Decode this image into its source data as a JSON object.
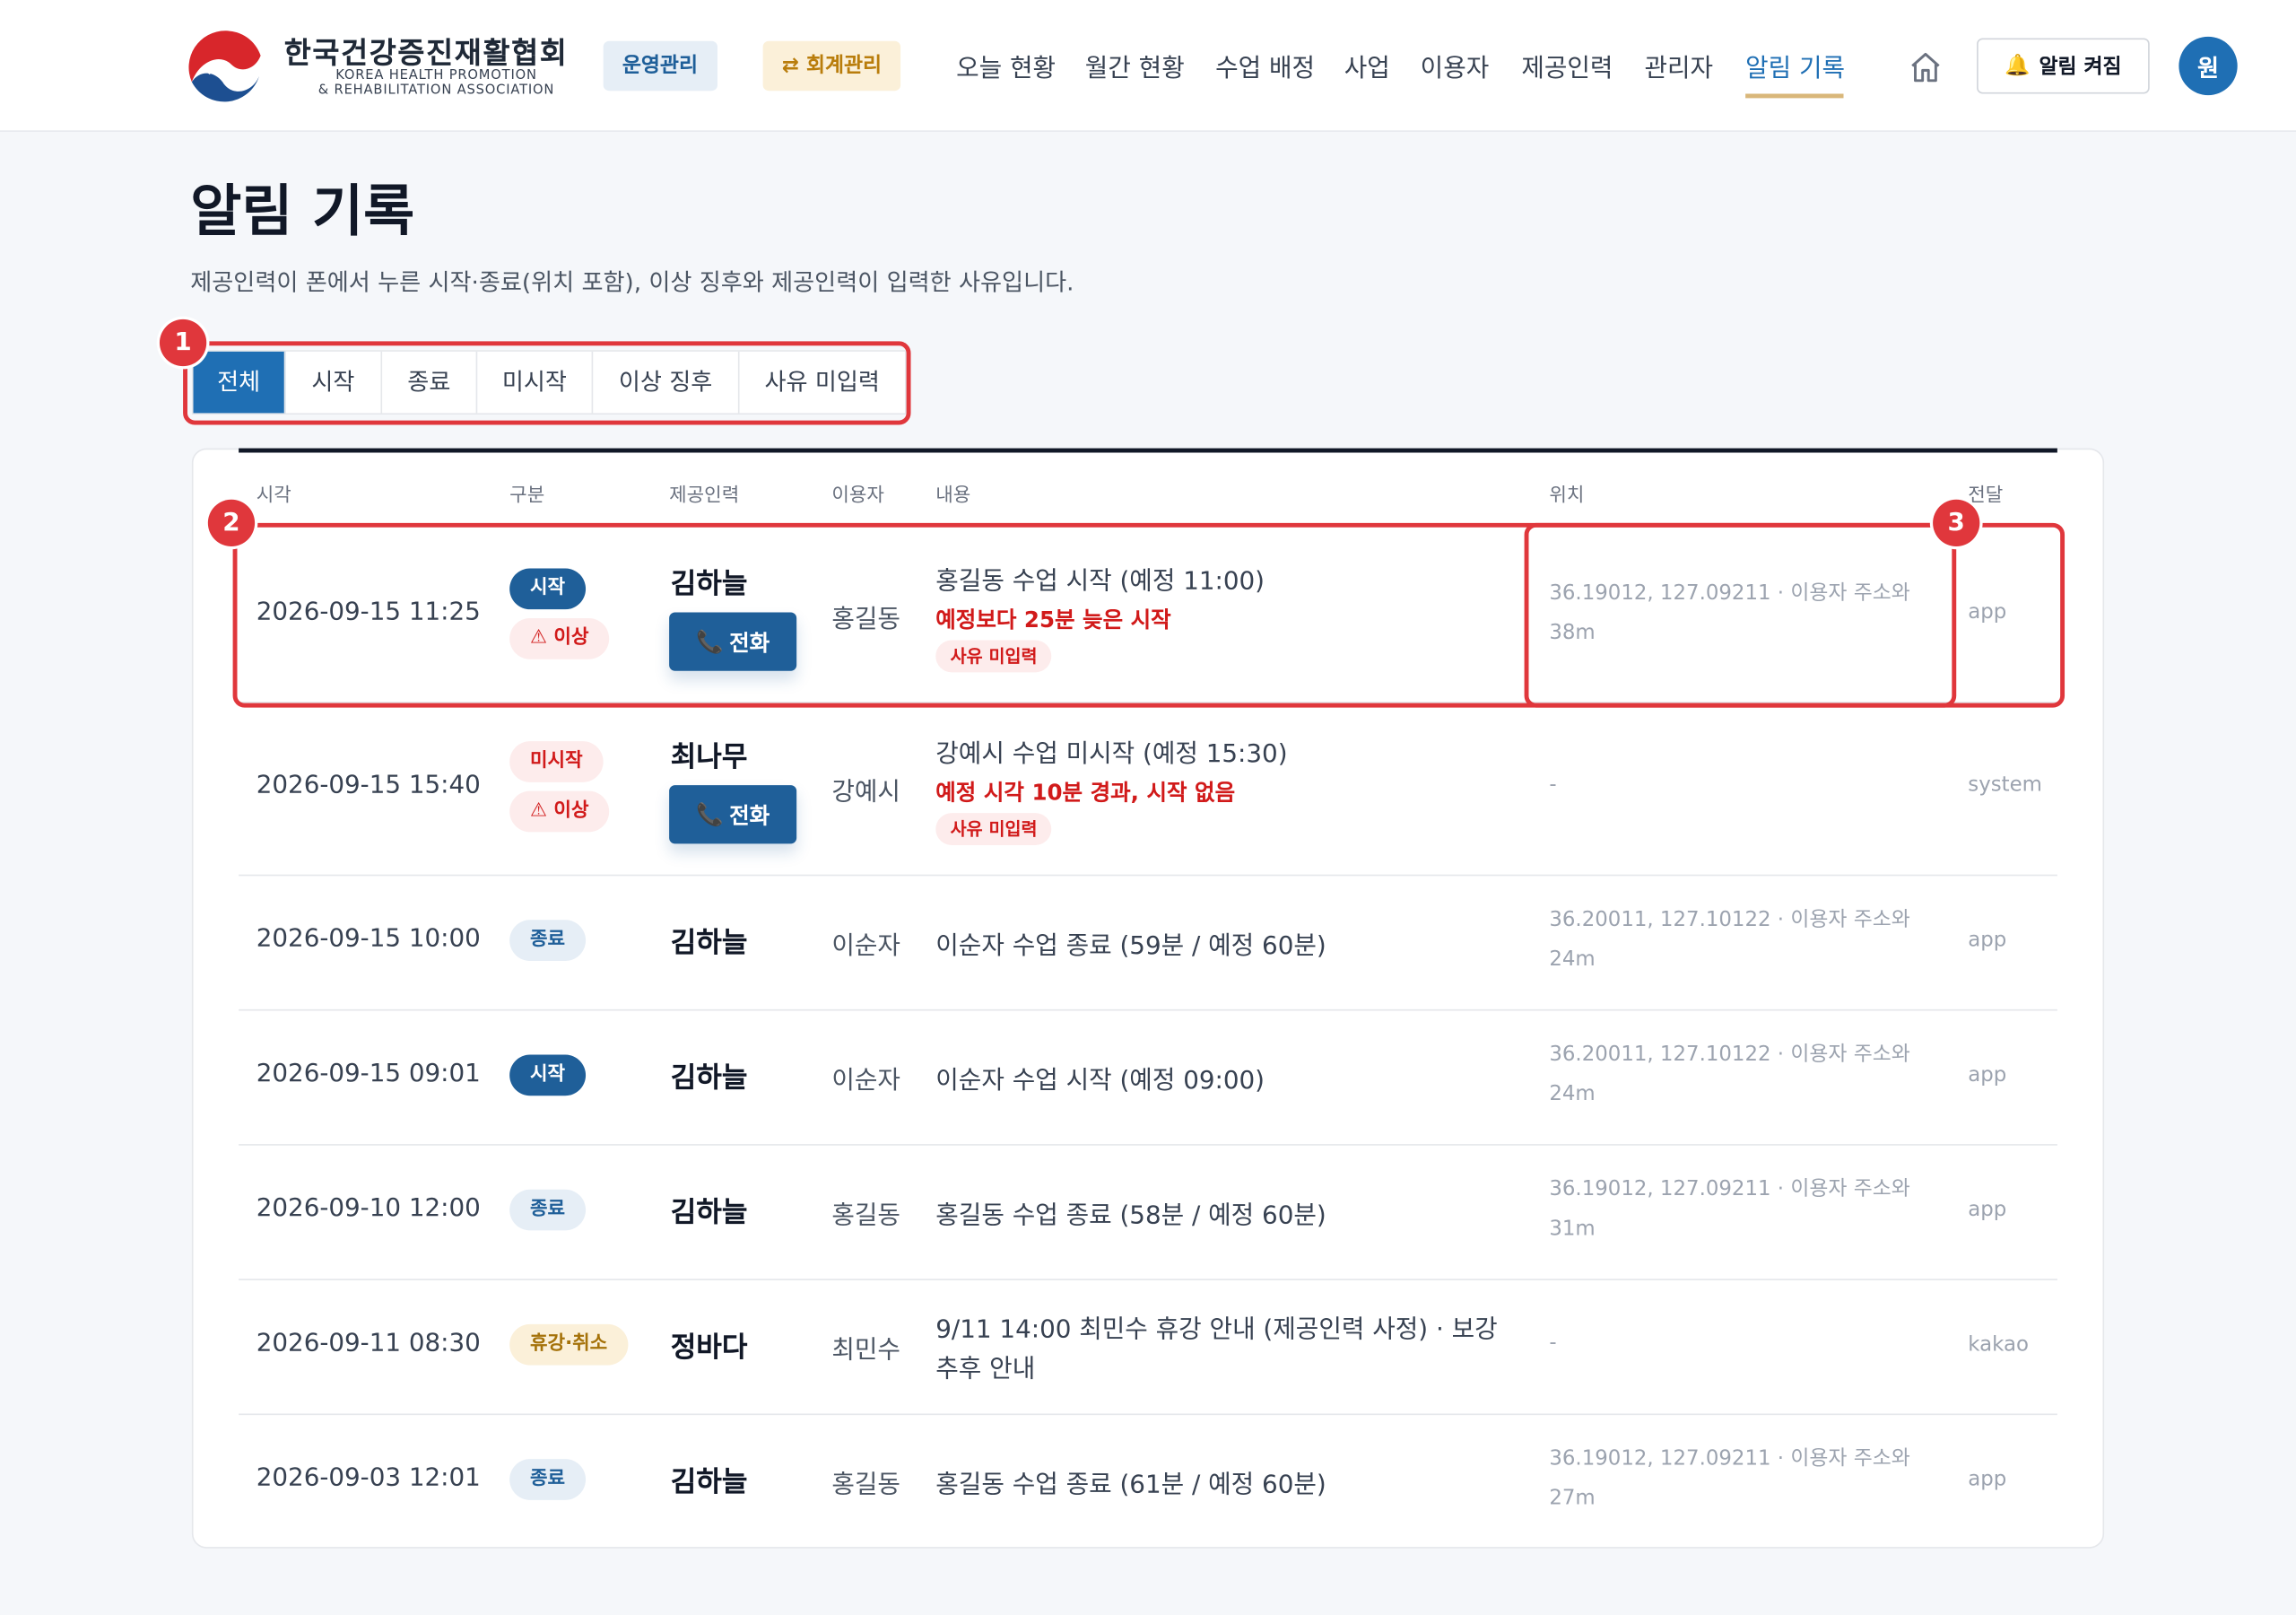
{
  "header": {
    "logo_ko": "한국건강증진재활협회",
    "logo_en_line1": "KOREA HEALTH PROMOTION",
    "logo_en_line2": "& REHABILITATION ASSOCIATION",
    "chip_ops": "운영관리",
    "chip_accounting": "⇄ 회계관리",
    "nav": [
      "오늘 현황",
      "월간 현황",
      "수업 배정",
      "사업",
      "이용자",
      "제공인력",
      "관리자",
      "알림 기록"
    ],
    "active_nav": "알림 기록",
    "home_icon": "home-icon",
    "alert_button": "알림 켜짐",
    "alert_icon": "bell-icon",
    "avatar": "원"
  },
  "page": {
    "title": "알림 기록",
    "description": "제공인력이 폰에서 누른 시작·종료(위치 포함), 이상 징후와 제공인력이 입력한 사유입니다."
  },
  "filters": {
    "tabs": [
      "전체",
      "시작",
      "종료",
      "미시작",
      "이상 징후",
      "사유 미입력"
    ],
    "selected": "전체"
  },
  "table": {
    "headers": [
      "시각",
      "구분",
      "제공인력",
      "이용자",
      "내용",
      "위치",
      "전달"
    ],
    "rows": [
      {
        "time": "2026-09-15 11:25",
        "badges": [
          "시작",
          "⚠ 이상"
        ],
        "provider": "김하늘",
        "call": "전화",
        "user": "홍길동",
        "content": "홍길동 수업 시작 (예정 11:00)",
        "warning": "예정보다 25분 늦은 시작",
        "tag": "사유 미입력",
        "location": "36.19012, 127.09211 · 이용자 주소와 38m",
        "channel": "app"
      },
      {
        "time": "2026-09-15 15:40",
        "badges": [
          "미시작",
          "⚠ 이상"
        ],
        "provider": "최나무",
        "call": "전화",
        "user": "강예시",
        "content": "강예시 수업 미시작 (예정 15:30)",
        "warning": "예정 시각 10분 경과, 시작 없음",
        "tag": "사유 미입력",
        "location": "-",
        "channel": "system"
      },
      {
        "time": "2026-09-15 10:00",
        "badges": [
          "종료"
        ],
        "provider": "김하늘",
        "user": "이순자",
        "content": "이순자 수업 종료 (59분 / 예정 60분)",
        "location": "36.20011, 127.10122 · 이용자 주소와 24m",
        "channel": "app"
      },
      {
        "time": "2026-09-15 09:01",
        "badges": [
          "시작"
        ],
        "provider": "김하늘",
        "user": "이순자",
        "content": "이순자 수업 시작 (예정 09:00)",
        "location": "36.20011, 127.10122 · 이용자 주소와 24m",
        "channel": "app"
      },
      {
        "time": "2026-09-10 12:00",
        "badges": [
          "종료"
        ],
        "provider": "김하늘",
        "user": "홍길동",
        "content": "홍길동 수업 종료 (58분 / 예정 60분)",
        "location": "36.19012, 127.09211 · 이용자 주소와 31m",
        "channel": "app"
      },
      {
        "time": "2026-09-11 08:30",
        "badges": [
          "휴강·취소"
        ],
        "provider": "정바다",
        "user": "최민수",
        "content": "9/11 14:00 최민수 휴강 안내 (제공인력 사정) · 보강",
        "content2": "추후 안내",
        "location": "-",
        "channel": "kakao"
      },
      {
        "time": "2026-09-03 12:01",
        "badges": [
          "종료"
        ],
        "provider": "김하늘",
        "user": "홍길동",
        "content": "홍길동 수업 종료 (61분 / 예정 60분)",
        "location": "36.19012, 127.09211 · 이용자 주소와 27m",
        "channel": "app"
      }
    ]
  },
  "annotations": [
    "1",
    "2",
    "3"
  ],
  "colors": {
    "brand_blue": "#1f6fb4",
    "dark_blue": "#1f5f99",
    "alert_red": "#d11a1a",
    "callout_red": "#e0373c",
    "gold": "#d9b77a"
  }
}
